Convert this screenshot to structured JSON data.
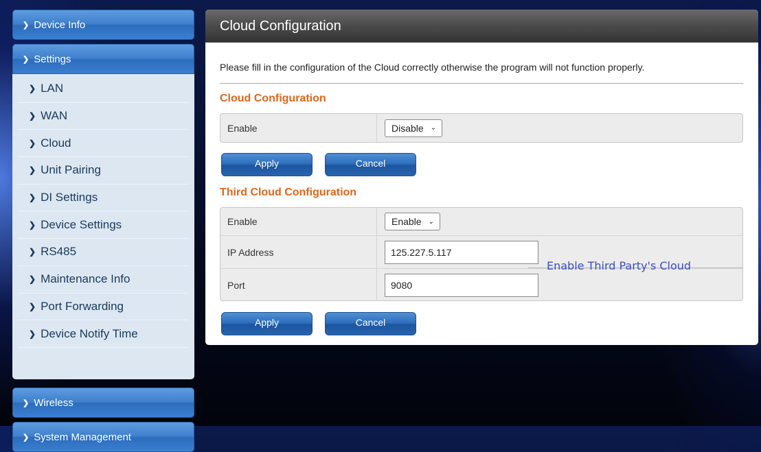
{
  "sidebar": {
    "sections": {
      "device_info": "Device Info",
      "settings": "Settings",
      "wireless": "Wireless",
      "system_management": "System Management"
    },
    "settings_items": [
      {
        "label": "LAN"
      },
      {
        "label": "WAN"
      },
      {
        "label": "Cloud"
      },
      {
        "label": "Unit Pairing"
      },
      {
        "label": "DI Settings"
      },
      {
        "label": "Device Settings"
      },
      {
        "label": "RS485"
      },
      {
        "label": "Maintenance Info"
      },
      {
        "label": "Port Forwarding"
      },
      {
        "label": "Device Notify Time"
      }
    ]
  },
  "main": {
    "title": "Cloud Configuration",
    "intro": "Please fill in the configuration of the Cloud correctly otherwise the program will not function properly.",
    "cloud": {
      "title": "Cloud Configuration",
      "enable_label": "Enable",
      "enable_value": "Disable",
      "apply_label": "Apply",
      "cancel_label": "Cancel"
    },
    "third_cloud": {
      "title": "Third Cloud Configuration",
      "enable_label": "Enable",
      "enable_value": "Enable",
      "ip_label": "IP Address",
      "ip_value": "125.227.5.117",
      "port_label": "Port",
      "port_value": "9080",
      "annotation": "Enable Third Party's Cloud",
      "apply_label": "Apply",
      "cancel_label": "Cancel"
    }
  },
  "icons": {
    "chevron": "chevron-right-icon",
    "caret": "chevron-down-icon"
  }
}
